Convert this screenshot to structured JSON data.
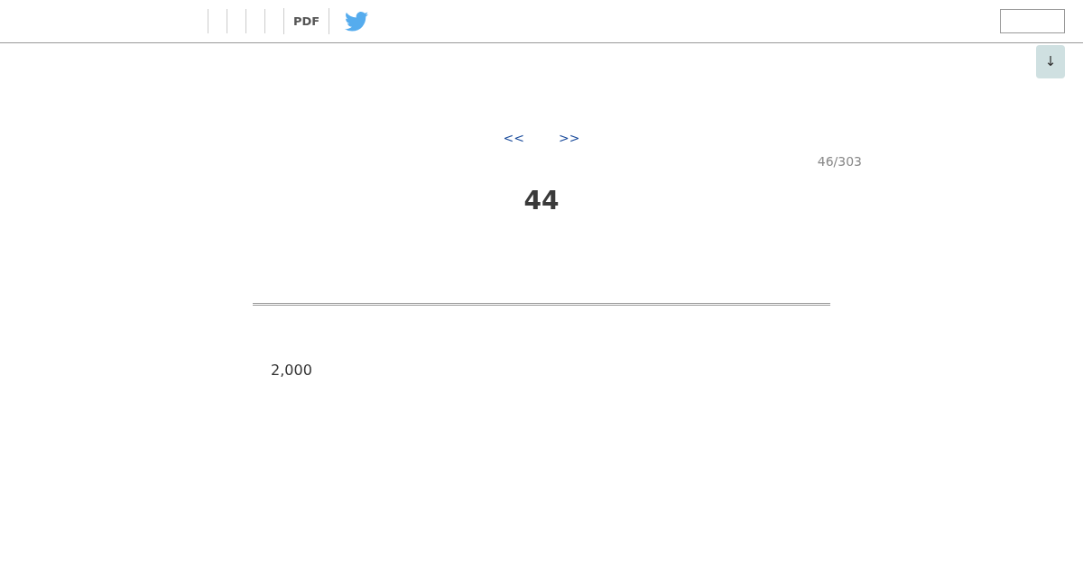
{
  "header": {
    "menu_links": [
      {
        "kind": "blank"
      },
      {
        "kind": "blank"
      },
      {
        "kind": "blank"
      },
      {
        "kind": "blank"
      },
      {
        "kind": "link",
        "label": "PDF"
      }
    ]
  },
  "scroll_button": {
    "label": "↓"
  },
  "pager": {
    "previous": "<<",
    "next": ">>",
    "counter": "46/303"
  },
  "heading": "44",
  "body_text": "2,000"
}
